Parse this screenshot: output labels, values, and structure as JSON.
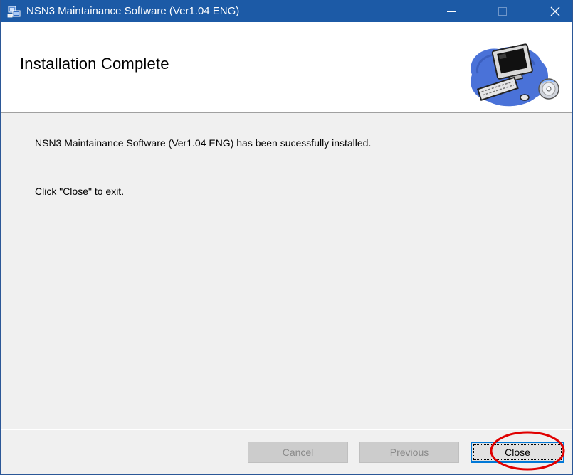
{
  "window": {
    "title": "NSN3 Maintainance Software (Ver1.04 ENG)",
    "titlebar_color": "#1c5aa6"
  },
  "header": {
    "title": "Installation Complete",
    "art_icon": "computer-setup-icon"
  },
  "body": {
    "message_installed": "NSN3 Maintainance Software (Ver1.04 ENG) has been sucessfully installed.",
    "message_exit": "Click \"Close\" to exit."
  },
  "buttons": {
    "cancel_label": "Cancel",
    "previous_label": "Previous",
    "close_label": "Close"
  },
  "annotation": {
    "highlight_color": "#e00000"
  }
}
